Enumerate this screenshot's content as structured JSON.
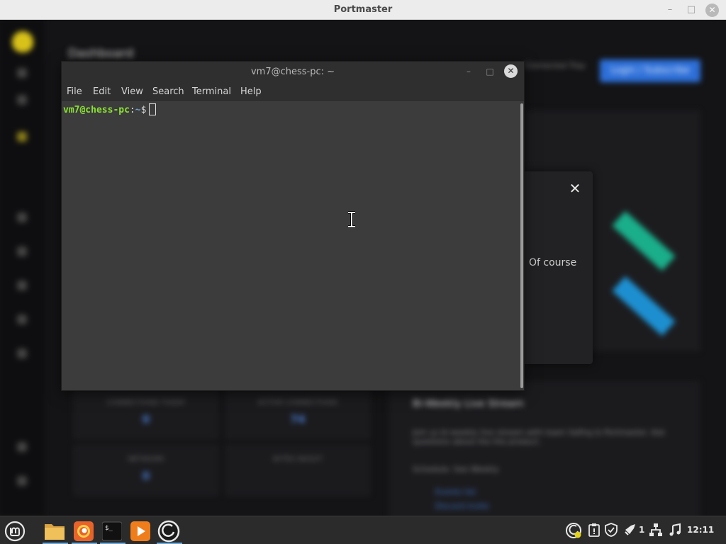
{
  "portmaster": {
    "title": "Portmaster",
    "heading": "Dashboard",
    "blue_button": "Login / Subscribe",
    "top_right_text": "Connected Tray",
    "cards": [
      {
        "label": "CONNECTIONS TODAY",
        "value": "0"
      },
      {
        "label": "ACTIVE CONNECTIONS",
        "value": "74"
      },
      {
        "label": "NETWORK",
        "value": "0"
      },
      {
        "label": "BYTES IN/OUT",
        "value": ""
      }
    ],
    "news": {
      "heading": "Bi-Weekly Live Stream",
      "body": "Join us bi-weekly live stream with team Safing & Portmaster. Ask questions about the the product.",
      "sub": "Schedule: See Weekly",
      "links": [
        "Events list",
        "Discord invite"
      ]
    }
  },
  "modal": {
    "visible_text": "Of course"
  },
  "terminal": {
    "title": "vm7@chess-pc: ~",
    "menu": [
      "File",
      "Edit",
      "View",
      "Search",
      "Terminal",
      "Help"
    ],
    "prompt_user": "vm7@chess-pc",
    "prompt_sep": ":",
    "prompt_path": "~",
    "prompt_dollar": "$"
  },
  "taskbar": {
    "apps": [
      "mint-menu-icon",
      "files-icon",
      "firefox-icon",
      "terminal-icon",
      "media-player-icon",
      "portmaster-icon"
    ],
    "notification_count": "1",
    "time": "12:11"
  }
}
